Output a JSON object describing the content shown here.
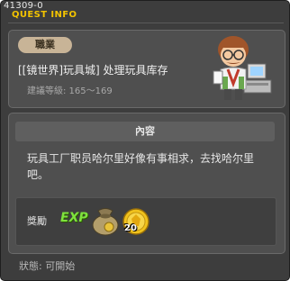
{
  "window": {
    "quest_id": "41309-0",
    "title": "QUEST INFO"
  },
  "quest": {
    "category": "職業",
    "name": "[[镜世界]玩具城] 处理玩具库存",
    "level_range": "建議等級: 165～169"
  },
  "content": {
    "header": "內容",
    "description": "玩具工厂职员哈尔里好像有事相求，去找哈尔里吧。"
  },
  "rewards": {
    "label": "獎勵",
    "exp_label": "EXP",
    "items": [
      {
        "icon": "money-bag-icon"
      },
      {
        "icon": "gold-coin-icon",
        "quantity": "20"
      }
    ]
  },
  "status": {
    "text": "狀態: 可開始"
  },
  "colors": {
    "title": "#f2c300",
    "exp": "#7ee23d",
    "background": "#3d3d3d",
    "panel": "#4f4f4f"
  }
}
